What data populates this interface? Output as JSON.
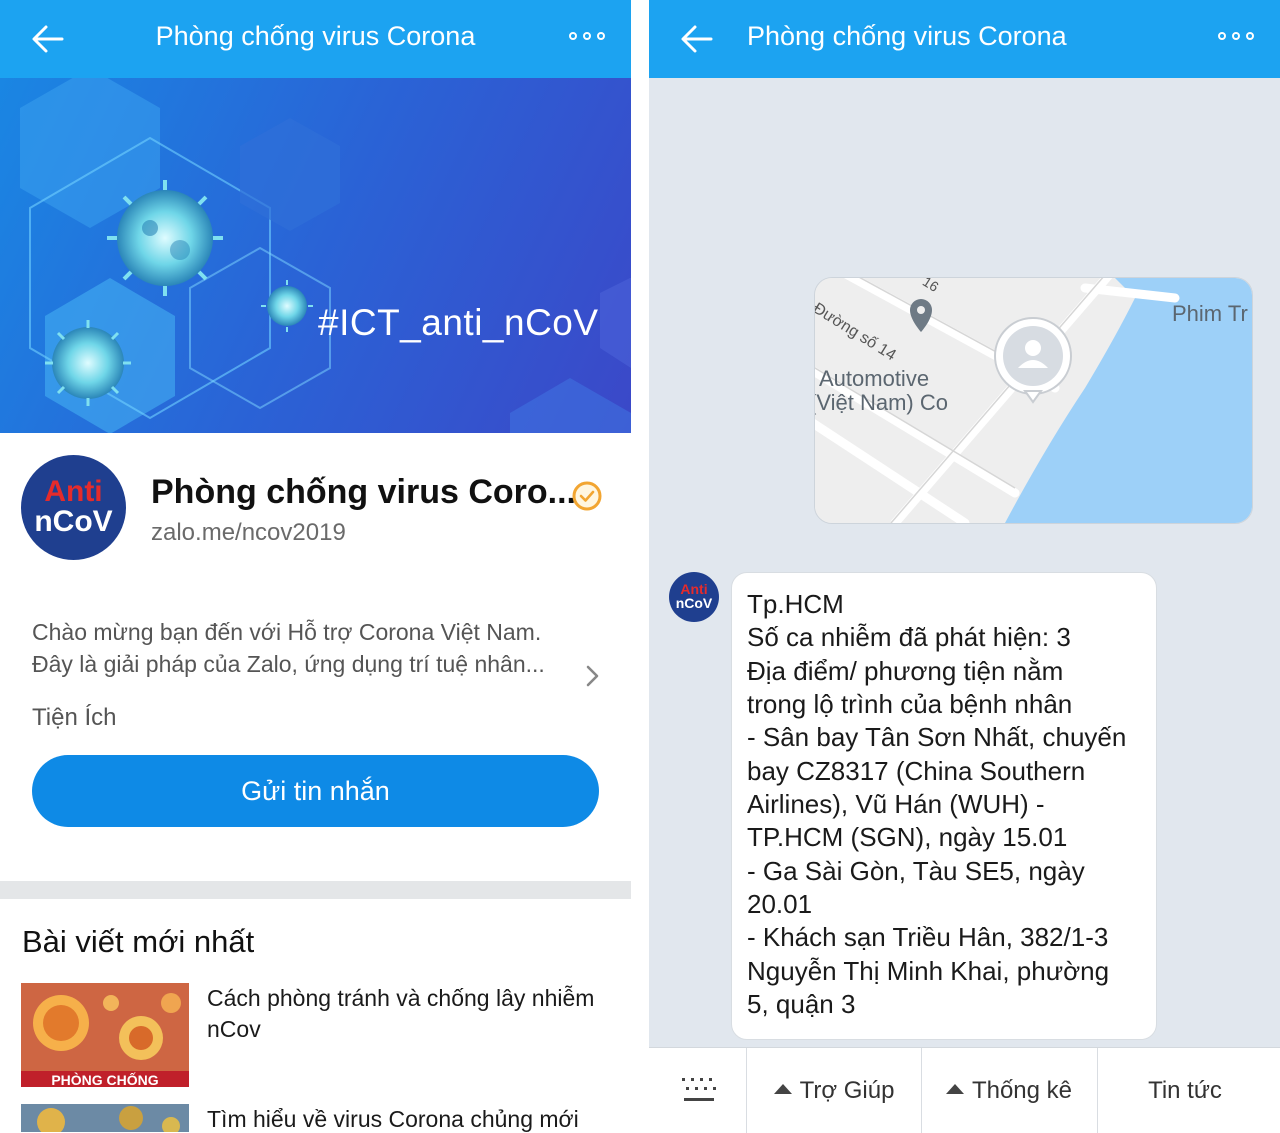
{
  "left_screen": {
    "header": {
      "title": "Phòng chống virus Corona"
    },
    "banner": {
      "hashtag": "#ICT_anti_nCoV"
    },
    "profile": {
      "avatar_line1": "Anti",
      "avatar_line2": "nCoV",
      "name": "Phòng chống virus Coro...",
      "link": "zalo.me/ncov2019",
      "description_line1": "Chào mừng bạn đến với Hỗ trợ Corona Việt Nam.",
      "description_line2": "Đây là giải pháp của Zalo, ứng dụng trí tuệ nhân...",
      "utilities_label": "Tiện Ích",
      "send_button": "Gửi tin nhắn"
    },
    "latest": {
      "title": "Bài viết mới nhất",
      "articles": [
        {
          "title": "Cách phòng tránh và chống lây nhiễm nCov",
          "thumb_caption": "PHÒNG CHỐNG"
        },
        {
          "title": "Tìm hiểu về virus Corona chủng mới"
        }
      ]
    }
  },
  "right_screen": {
    "header": {
      "title": "Phòng chống virus Corona"
    },
    "map": {
      "road_label": "Đường số 14",
      "road_number": "16",
      "poi_line1": "Automotive",
      "poi_line2": "(Việt Nam) Co",
      "place_label": "Phim Tr"
    },
    "message": {
      "avatar_line1": "Anti",
      "avatar_line2": "nCoV",
      "lines": [
        "Tp.HCM",
        "Số ca nhiễm đã phát hiện: 3",
        "Địa điểm/ phương tiện nằm",
        "trong lộ trình của bệnh nhân",
        "- Sân bay Tân Sơn Nhất, chuyến",
        "bay CZ8317 (China Southern",
        "Airlines), Vũ Hán (WUH) -",
        "TP.HCM (SGN), ngày 15.01",
        "- Ga Sài Gòn, Tàu SE5, ngày",
        "20.01",
        "- Khách sạn Triều Hân, 382/1-3",
        "Nguyễn Thị Minh Khai, phường",
        "5, quận 3"
      ]
    },
    "bottom_menu": {
      "help": "Trợ Giúp",
      "stats": "Thống kê",
      "news": "Tin tức"
    }
  },
  "colors": {
    "header_blue": "#1ca3f1",
    "button_blue": "#0e8ae6",
    "chat_background": "#e1e7ee",
    "verified_orange": "#f2a531",
    "avatar_navy": "#1f3f8f",
    "water_blue": "#9dd0f8"
  }
}
